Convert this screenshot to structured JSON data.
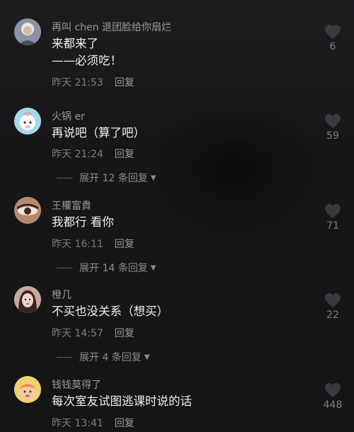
{
  "comments": [
    {
      "username": "再叫 chen 退团脸给你扇烂",
      "text_lines": [
        "来都来了",
        "——必须吃！"
      ],
      "time": "昨天 21:53",
      "reply_label": "回复",
      "likes": "6",
      "avatar_icon": "avatar-white-hair-person"
    },
    {
      "username": "火锅 er",
      "text_lines": [
        "再说吧（算了吧）"
      ],
      "time": "昨天 21:24",
      "reply_label": "回复",
      "likes": "59",
      "avatar_icon": "avatar-unicorn-cartoon",
      "expand_label": "展开 12 条回复"
    },
    {
      "username": "王權富貴",
      "text_lines": [
        "我都行 看你"
      ],
      "time": "昨天 16:11",
      "reply_label": "回复",
      "likes": "71",
      "avatar_icon": "avatar-eye-closeup",
      "expand_label": "展开 14 条回复"
    },
    {
      "username": "橙几",
      "text_lines": [
        "不买也没关系（想买）"
      ],
      "time": "昨天 14:57",
      "reply_label": "回复",
      "likes": "22",
      "avatar_icon": "avatar-girl-photo",
      "expand_label": "展开 4 条回复"
    },
    {
      "username": "钱钱莫得了",
      "text_lines": [
        "每次室友试图逃课时说的话"
      ],
      "time": "昨天 13:41",
      "reply_label": "回复",
      "likes": "448",
      "avatar_icon": "avatar-cartoon-child"
    }
  ],
  "colors": {
    "background": "#141416",
    "username": "#9a9a9e",
    "text": "#f1f1f3",
    "meta": "#7e7e83",
    "heart": "#3a3a3e"
  },
  "icons": {
    "like": "heart-icon",
    "expand": "caret-down-icon"
  }
}
